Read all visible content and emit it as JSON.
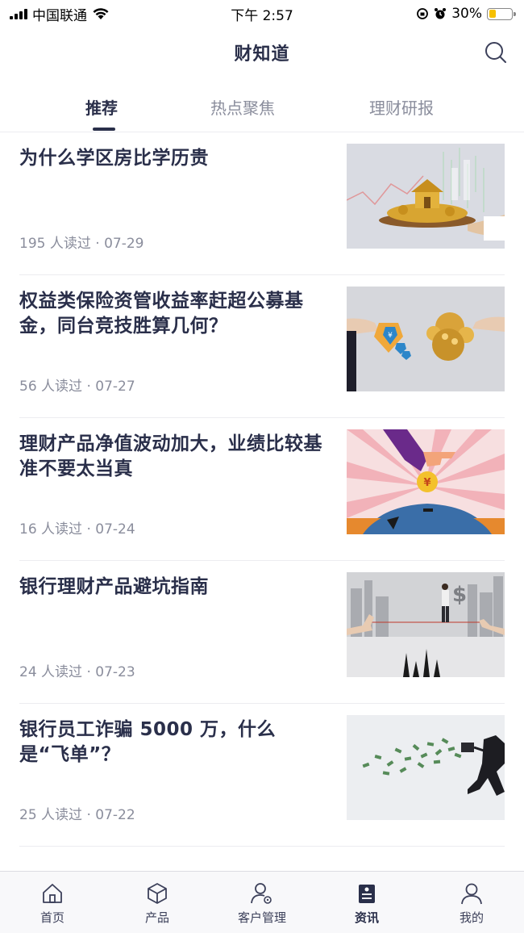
{
  "status_bar": {
    "carrier": "中国联通",
    "time": "下午 2:57",
    "battery_percent_text": "30%",
    "battery_level": 0.3
  },
  "nav": {
    "title": "财知道",
    "search_icon": "search-icon"
  },
  "tabs": [
    {
      "label": "推荐",
      "active": true
    },
    {
      "label": "热点聚焦",
      "active": false
    },
    {
      "label": "理财研报",
      "active": false
    }
  ],
  "articles": [
    {
      "title": "为什么学区房比学历贵",
      "reads": "195 人读过",
      "date": "07-29"
    },
    {
      "title": "权益类保险资管收益率赶超公募基金，同台竞技胜算几何？",
      "reads": "56 人读过",
      "date": "07-27"
    },
    {
      "title": "理财产品净值波动加大，业绩比较基准不要太当真",
      "reads": "16 人读过",
      "date": "07-24"
    },
    {
      "title": "银行理财产品避坑指南",
      "reads": "24 人读过",
      "date": "07-23"
    },
    {
      "title": "银行员工诈骗 5000 万，什么是“飞单”？",
      "reads": "25 人读过",
      "date": "07-22"
    }
  ],
  "tab_bar": [
    {
      "label": "首页",
      "icon": "home-icon"
    },
    {
      "label": "产品",
      "icon": "box-icon"
    },
    {
      "label": "客户管理",
      "icon": "user-settings-icon"
    },
    {
      "label": "资讯",
      "icon": "news-icon",
      "active": true
    },
    {
      "label": "我的",
      "icon": "profile-icon"
    }
  ]
}
